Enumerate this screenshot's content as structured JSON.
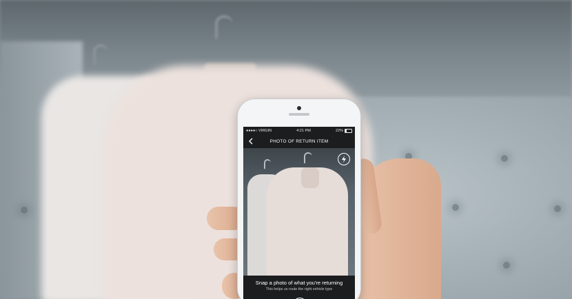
{
  "status_bar": {
    "carrier": "●●●●○ VIRGIN",
    "time": "4:21 PM",
    "battery": "22%"
  },
  "nav": {
    "title": "PHOTO OF RETURN ITEM"
  },
  "camera": {
    "caption_main": "Snap a photo of what you're returning",
    "caption_sub": "This helps us route the right vehicle type"
  }
}
